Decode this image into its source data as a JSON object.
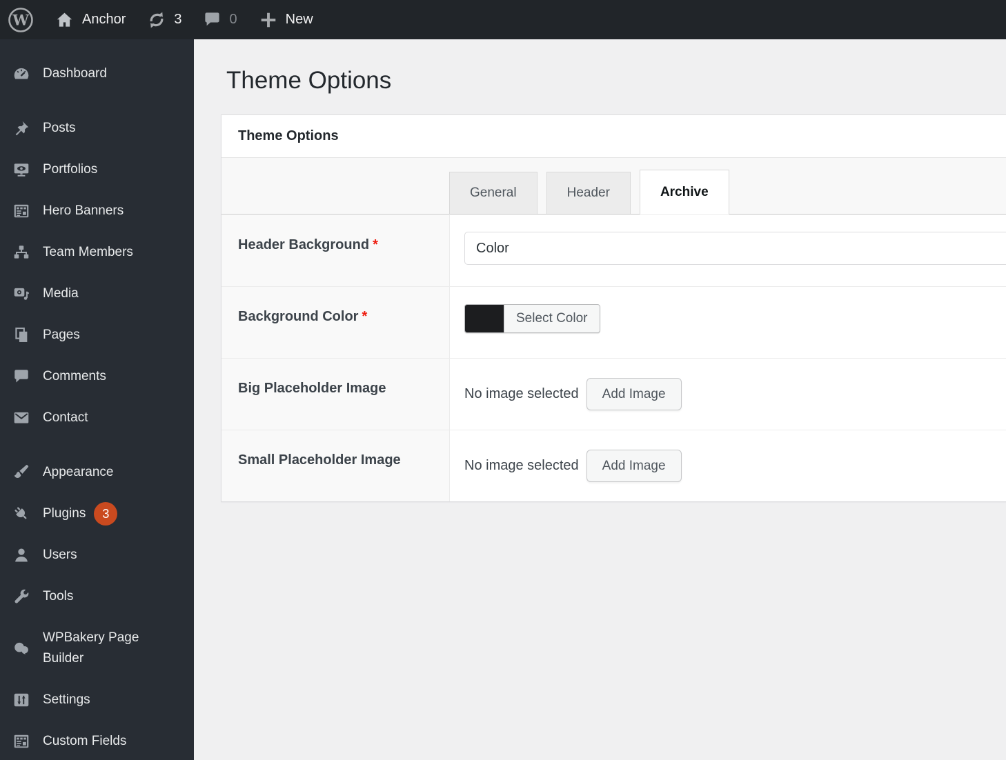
{
  "admin_bar": {
    "site_label": "Anchor",
    "updates_count": "3",
    "comments_count": "0",
    "new_label": "New"
  },
  "sidebar": {
    "badge_color": "#ca4a1f",
    "items": [
      {
        "label": "Dashboard",
        "icon": "dashboard-gauge-icon"
      },
      {
        "label": "Posts",
        "icon": "pushpin-icon"
      },
      {
        "label": "Portfolios",
        "icon": "portfolio-screen-icon"
      },
      {
        "label": "Hero Banners",
        "icon": "banner-table-icon"
      },
      {
        "label": "Team Members",
        "icon": "org-chart-icon"
      },
      {
        "label": "Media",
        "icon": "camera-note-icon"
      },
      {
        "label": "Pages",
        "icon": "stacked-pages-icon"
      },
      {
        "label": "Comments",
        "icon": "comment-bubble-icon"
      },
      {
        "label": "Contact",
        "icon": "envelope-icon"
      },
      {
        "label": "Appearance",
        "icon": "paintbrush-icon"
      },
      {
        "label": "Plugins",
        "icon": "plug-icon",
        "badge": "3"
      },
      {
        "label": "Users",
        "icon": "user-icon"
      },
      {
        "label": "Tools",
        "icon": "wrench-icon"
      },
      {
        "label": "WPBakery Page Builder",
        "icon": "wpbakery-icon"
      },
      {
        "label": "Settings",
        "icon": "sliders-icon"
      },
      {
        "label": "Custom Fields",
        "icon": "custom-fields-table-icon"
      }
    ]
  },
  "page": {
    "title": "Theme Options"
  },
  "panel": {
    "title": "Theme Options",
    "tabs": [
      {
        "label": "General",
        "active": false
      },
      {
        "label": "Header",
        "active": false
      },
      {
        "label": "Archive",
        "active": true
      }
    ],
    "rows": [
      {
        "label": "Header Background",
        "required_mark": "*",
        "control": "select",
        "value": "Color"
      },
      {
        "label": "Background Color",
        "required_mark": "*",
        "control": "color-picker",
        "swatch_color": "#1c1d1f",
        "button_label": "Select Color"
      },
      {
        "label": "Big Placeholder Image",
        "control": "image-upload",
        "status": "No image selected",
        "button_label": "Add Image"
      },
      {
        "label": "Small Placeholder Image",
        "control": "image-upload",
        "status": "No image selected",
        "button_label": "Add Image"
      }
    ]
  }
}
